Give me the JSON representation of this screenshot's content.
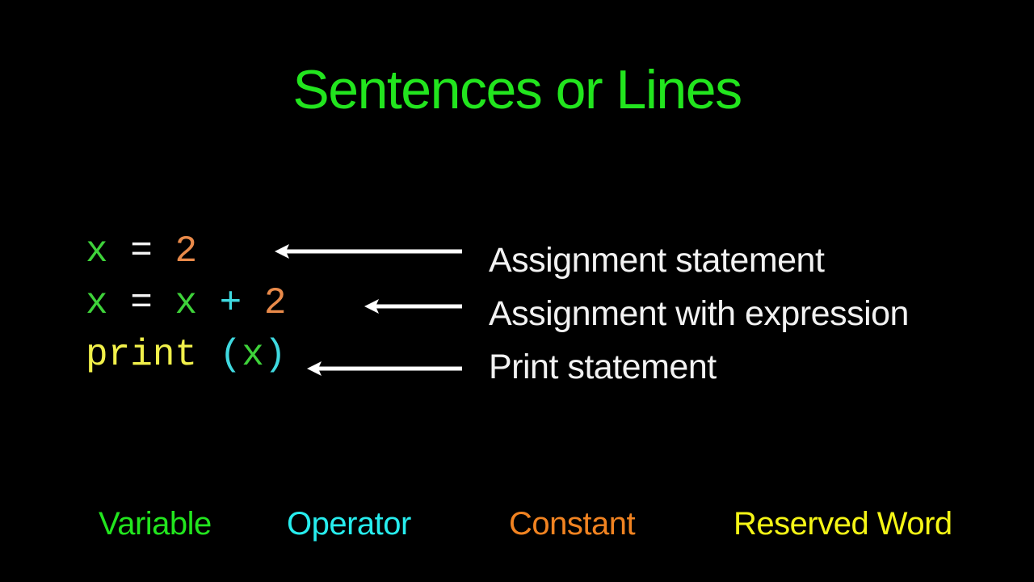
{
  "title": "Sentences or Lines",
  "code_lines": [
    {
      "tokens": [
        {
          "text": "x",
          "type": "variable"
        },
        {
          "text": " = ",
          "type": "operator"
        },
        {
          "text": "2",
          "type": "constant"
        }
      ]
    },
    {
      "tokens": [
        {
          "text": "x",
          "type": "variable"
        },
        {
          "text": " = ",
          "type": "operator"
        },
        {
          "text": "x",
          "type": "variable"
        },
        {
          "text": " + ",
          "type": "operator_plus"
        },
        {
          "text": "2",
          "type": "constant"
        }
      ]
    },
    {
      "tokens": [
        {
          "text": "print",
          "type": "reserved"
        },
        {
          "text": " (",
          "type": "paren"
        },
        {
          "text": "x",
          "type": "variable"
        },
        {
          "text": ")",
          "type": "paren"
        }
      ]
    }
  ],
  "descriptions": [
    "Assignment statement",
    "Assignment with expression",
    "Print statement"
  ],
  "legend": [
    {
      "label": "Variable",
      "color": "#22e51e"
    },
    {
      "label": "Operator",
      "color": "#27edee"
    },
    {
      "label": "Constant",
      "color": "#f18321"
    },
    {
      "label": "Reserved Word",
      "color": "#f5f516"
    }
  ],
  "icons": {
    "arrow": "arrow-left-icon"
  }
}
